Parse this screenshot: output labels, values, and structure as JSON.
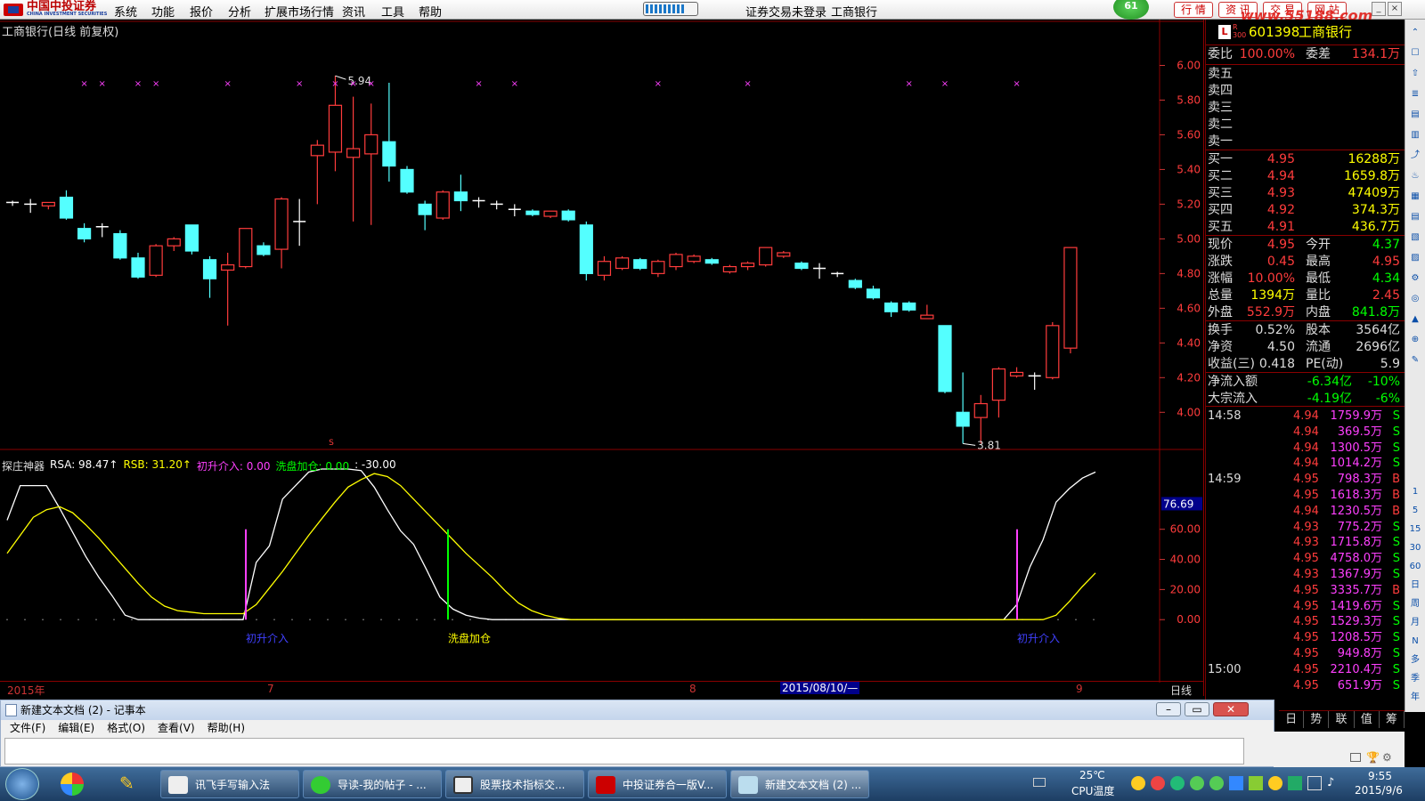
{
  "menubar": {
    "logo_cn": "中国中投证券",
    "logo_en": "CHINA INVESTMENT SECURITIES",
    "items": [
      "系统",
      "功能",
      "报价",
      "分析",
      "扩展市场行情",
      "资讯",
      "工具",
      "帮助"
    ],
    "status": "证券交易未登录",
    "stock_name": "工商银行",
    "badge": "61",
    "tabs": [
      "行 情",
      "资 讯",
      "交 易",
      "网 站"
    ],
    "watermark": "www.55188.com"
  },
  "chart": {
    "title": "工商银行(日线 前复权)",
    "price_high_label": "5.94",
    "price_low_label": "3.81",
    "price_axis": [
      "6.00",
      "5.80",
      "5.60",
      "5.40",
      "5.20",
      "5.00",
      "4.80",
      "4.60",
      "4.40",
      "4.20",
      "4.00"
    ],
    "indicator_axis": [
      "76.69",
      "60.00",
      "40.00",
      "20.00",
      "0.00"
    ],
    "timeline": [
      "2015年",
      "7",
      "8",
      "2015/08/10/—",
      "9"
    ],
    "period_label": "日线",
    "indicator_title": "探庄神器",
    "indicator_values": [
      {
        "text": "RSA: 98.47↑",
        "color": "#ffffff"
      },
      {
        "text": "RSB: 31.20↑",
        "color": "#ffff00"
      },
      {
        "text": "初升介入: 0.00",
        "color": "#ff40ff"
      },
      {
        "text": "洗盘加仓: 0.00",
        "color": "#00ff00"
      },
      {
        "text": ": -30.00",
        "color": "#ffffff"
      }
    ],
    "signal_labels": [
      {
        "text": "初升介入",
        "color": "#4040ff"
      },
      {
        "text": "洗盘加仓",
        "color": "#ffff00"
      },
      {
        "text": "初升介入",
        "color": "#4040ff"
      }
    ]
  },
  "chart_data": {
    "type": "candlestick",
    "title": "工商银行(日线 前复权)",
    "ylim": [
      3.75,
      6.1
    ],
    "candles": [
      {
        "o": 5.2,
        "c": 5.21,
        "h": 5.22,
        "l": 5.19
      },
      {
        "o": 5.19,
        "c": 5.2,
        "h": 5.23,
        "l": 5.15
      },
      {
        "o": 5.19,
        "c": 5.21,
        "h": 5.21,
        "l": 5.17
      },
      {
        "o": 5.24,
        "c": 5.12,
        "h": 5.28,
        "l": 5.11
      },
      {
        "o": 5.06,
        "c": 5.0,
        "h": 5.09,
        "l": 4.98
      },
      {
        "o": 5.06,
        "c": 5.07,
        "h": 5.09,
        "l": 5.01
      },
      {
        "o": 5.03,
        "c": 4.89,
        "h": 5.05,
        "l": 4.88
      },
      {
        "o": 4.89,
        "c": 4.78,
        "h": 4.92,
        "l": 4.77
      },
      {
        "o": 4.79,
        "c": 4.96,
        "h": 4.97,
        "l": 4.78
      },
      {
        "o": 4.96,
        "c": 5.0,
        "h": 5.01,
        "l": 4.93
      },
      {
        "o": 5.08,
        "c": 4.93,
        "h": 5.08,
        "l": 4.91
      },
      {
        "o": 4.88,
        "c": 4.77,
        "h": 4.9,
        "l": 4.66
      },
      {
        "o": 4.82,
        "c": 4.85,
        "h": 4.92,
        "l": 4.5
      },
      {
        "o": 4.84,
        "c": 5.06,
        "h": 5.06,
        "l": 4.83
      },
      {
        "o": 4.96,
        "c": 4.91,
        "h": 4.98,
        "l": 4.9
      },
      {
        "o": 4.94,
        "c": 5.23,
        "h": 5.24,
        "l": 4.83
      },
      {
        "o": 5.09,
        "c": 5.1,
        "h": 5.23,
        "l": 4.96
      },
      {
        "o": 5.48,
        "c": 5.54,
        "h": 5.57,
        "l": 5.2
      },
      {
        "o": 5.5,
        "c": 5.77,
        "h": 5.94,
        "l": 5.39
      },
      {
        "o": 5.47,
        "c": 5.52,
        "h": 5.82,
        "l": 5.1
      },
      {
        "o": 5.49,
        "c": 5.6,
        "h": 5.78,
        "l": 5.08
      },
      {
        "o": 5.56,
        "c": 5.42,
        "h": 5.9,
        "l": 5.33
      },
      {
        "o": 5.4,
        "c": 5.27,
        "h": 5.42,
        "l": 5.26
      },
      {
        "o": 5.2,
        "c": 5.14,
        "h": 5.22,
        "l": 5.05
      },
      {
        "o": 5.12,
        "c": 5.27,
        "h": 5.28,
        "l": 5.11
      },
      {
        "o": 5.27,
        "c": 5.22,
        "h": 5.37,
        "l": 5.16
      },
      {
        "o": 5.22,
        "c": 5.21,
        "h": 5.24,
        "l": 5.18
      },
      {
        "o": 5.2,
        "c": 5.19,
        "h": 5.22,
        "l": 5.17
      },
      {
        "o": 5.17,
        "c": 5.16,
        "h": 5.2,
        "l": 5.13
      },
      {
        "o": 5.16,
        "c": 5.14,
        "h": 5.17,
        "l": 5.13
      },
      {
        "o": 5.13,
        "c": 5.16,
        "h": 5.16,
        "l": 5.12
      },
      {
        "o": 5.16,
        "c": 5.11,
        "h": 5.17,
        "l": 5.1
      },
      {
        "o": 5.08,
        "c": 4.8,
        "h": 5.1,
        "l": 4.76
      },
      {
        "o": 4.79,
        "c": 4.87,
        "h": 4.9,
        "l": 4.76
      },
      {
        "o": 4.83,
        "c": 4.89,
        "h": 4.9,
        "l": 4.82
      },
      {
        "o": 4.88,
        "c": 4.83,
        "h": 4.89,
        "l": 4.82
      },
      {
        "o": 4.8,
        "c": 4.87,
        "h": 4.88,
        "l": 4.78
      },
      {
        "o": 4.84,
        "c": 4.91,
        "h": 4.92,
        "l": 4.82
      },
      {
        "o": 4.87,
        "c": 4.9,
        "h": 4.91,
        "l": 4.86
      },
      {
        "o": 4.88,
        "c": 4.86,
        "h": 4.89,
        "l": 4.85
      },
      {
        "o": 4.81,
        "c": 4.84,
        "h": 4.85,
        "l": 4.8
      },
      {
        "o": 4.84,
        "c": 4.86,
        "h": 4.87,
        "l": 4.82
      },
      {
        "o": 4.85,
        "c": 4.95,
        "h": 4.95,
        "l": 4.84
      },
      {
        "o": 4.9,
        "c": 4.92,
        "h": 4.93,
        "l": 4.89
      },
      {
        "o": 4.86,
        "c": 4.83,
        "h": 4.87,
        "l": 4.82
      },
      {
        "o": 4.83,
        "c": 4.82,
        "h": 4.86,
        "l": 4.77
      },
      {
        "o": 4.8,
        "c": 4.79,
        "h": 4.81,
        "l": 4.78
      },
      {
        "o": 4.76,
        "c": 4.72,
        "h": 4.77,
        "l": 4.71
      },
      {
        "o": 4.71,
        "c": 4.66,
        "h": 4.73,
        "l": 4.65
      },
      {
        "o": 4.63,
        "c": 4.58,
        "h": 4.64,
        "l": 4.55
      },
      {
        "o": 4.63,
        "c": 4.59,
        "h": 4.64,
        "l": 4.58
      },
      {
        "o": 4.54,
        "c": 4.56,
        "h": 4.62,
        "l": 4.54
      },
      {
        "o": 4.5,
        "c": 4.12,
        "h": 4.5,
        "l": 4.11
      },
      {
        "o": 4.0,
        "c": 3.92,
        "h": 4.23,
        "l": 3.82
      },
      {
        "o": 3.97,
        "c": 4.05,
        "h": 4.1,
        "l": 3.82
      },
      {
        "o": 4.07,
        "c": 4.25,
        "h": 4.26,
        "l": 3.97
      },
      {
        "o": 4.21,
        "c": 4.23,
        "h": 4.26,
        "l": 4.2
      },
      {
        "o": 4.2,
        "c": 4.21,
        "h": 4.23,
        "l": 4.13
      },
      {
        "o": 4.2,
        "c": 4.5,
        "h": 4.52,
        "l": 4.19
      },
      {
        "o": 4.37,
        "c": 4.95,
        "h": 4.95,
        "l": 4.34
      }
    ],
    "rsa": [
      66,
      89,
      89,
      89,
      74,
      58,
      42,
      28,
      16,
      3,
      0,
      0,
      0,
      0,
      0,
      0,
      0,
      0,
      0,
      38,
      49,
      80,
      89,
      98,
      100,
      100,
      100,
      99,
      88,
      73,
      59,
      50,
      33,
      15,
      7,
      3,
      1,
      0,
      0,
      0,
      0,
      0,
      0,
      0,
      0,
      0,
      0,
      0,
      0,
      0,
      0,
      0,
      0,
      0,
      0,
      0,
      0,
      0,
      0,
      0,
      0,
      0,
      0,
      0,
      0,
      0,
      0,
      0,
      0,
      0,
      0,
      0,
      0,
      0,
      0,
      0,
      0,
      10,
      35,
      53,
      78,
      87,
      94,
      98
    ],
    "rsb": [
      44,
      56,
      68,
      73,
      75,
      71,
      63,
      54,
      44,
      34,
      24,
      15,
      9,
      6,
      5,
      4,
      4,
      4,
      4,
      10,
      21,
      32,
      44,
      56,
      67,
      78,
      88,
      93,
      97,
      95,
      89,
      80,
      71,
      62,
      53,
      44,
      36,
      28,
      19,
      11,
      6,
      3,
      1,
      0,
      0,
      0,
      0,
      0,
      0,
      0,
      0,
      0,
      0,
      0,
      0,
      0,
      0,
      0,
      0,
      0,
      0,
      0,
      0,
      0,
      0,
      0,
      0,
      0,
      0,
      0,
      0,
      0,
      0,
      0,
      0,
      0,
      0,
      0,
      0,
      0,
      3,
      12,
      22,
      31
    ],
    "indicator_ylim": [
      -30,
      100
    ]
  },
  "quote": {
    "code": "601398",
    "name": "工商银行",
    "weibi_label": "委比",
    "weibi": "100.00%",
    "weicha_label": "委差",
    "weicha": "134.1万",
    "sell": [
      {
        "label": "卖五"
      },
      {
        "label": "卖四"
      },
      {
        "label": "卖三"
      },
      {
        "label": "卖二"
      },
      {
        "label": "卖一"
      }
    ],
    "buy": [
      {
        "label": "买一",
        "price": "4.95",
        "vol": "16288万"
      },
      {
        "label": "买二",
        "price": "4.94",
        "vol": "1659.8万"
      },
      {
        "label": "买三",
        "price": "4.93",
        "vol": "47409万"
      },
      {
        "label": "买四",
        "price": "4.92",
        "vol": "374.3万"
      },
      {
        "label": "买五",
        "price": "4.91",
        "vol": "436.7万"
      }
    ],
    "stats": [
      {
        "l1": "现价",
        "v1": "4.95",
        "c1": "#ff3c3c",
        "l2": "今开",
        "v2": "4.37",
        "c2": "#00ff00"
      },
      {
        "l1": "涨跌",
        "v1": "0.45",
        "c1": "#ff3c3c",
        "l2": "最高",
        "v2": "4.95",
        "c2": "#ff3c3c"
      },
      {
        "l1": "涨幅",
        "v1": "10.00%",
        "c1": "#ff3c3c",
        "l2": "最低",
        "v2": "4.34",
        "c2": "#00ff00"
      },
      {
        "l1": "总量",
        "v1": "1394万",
        "c1": "#ffff00",
        "l2": "量比",
        "v2": "2.45",
        "c2": "#ff3c3c"
      },
      {
        "l1": "外盘",
        "v1": "552.9万",
        "c1": "#ff3c3c",
        "l2": "内盘",
        "v2": "841.8万",
        "c2": "#00ff00"
      }
    ],
    "stats2": [
      {
        "l1": "换手",
        "v1": "0.52%",
        "l2": "股本",
        "v2": "3564亿"
      },
      {
        "l1": "净资",
        "v1": "4.50",
        "l2": "流通",
        "v2": "2696亿"
      },
      {
        "l1": "收益(三)",
        "v1": "0.418",
        "l2": "PE(动)",
        "v2": "5.9"
      }
    ],
    "flows": [
      {
        "label": "净流入额",
        "v1": "-6.34亿",
        "v2": "-10%"
      },
      {
        "label": "大宗流入",
        "v1": "-4.19亿",
        "v2": "-6%"
      }
    ],
    "ticks": [
      {
        "time": "14:58",
        "price": "4.94",
        "vol": "1759.9万",
        "bs": "S"
      },
      {
        "time": "",
        "price": "4.94",
        "vol": "369.5万",
        "bs": "S"
      },
      {
        "time": "",
        "price": "4.94",
        "vol": "1300.5万",
        "bs": "S"
      },
      {
        "time": "",
        "price": "4.94",
        "vol": "1014.2万",
        "bs": "S"
      },
      {
        "time": "14:59",
        "price": "4.95",
        "vol": "798.3万",
        "bs": "B"
      },
      {
        "time": "",
        "price": "4.95",
        "vol": "1618.3万",
        "bs": "B"
      },
      {
        "time": "",
        "price": "4.94",
        "vol": "1230.5万",
        "bs": "B"
      },
      {
        "time": "",
        "price": "4.93",
        "vol": "775.2万",
        "bs": "S"
      },
      {
        "time": "",
        "price": "4.93",
        "vol": "1715.8万",
        "bs": "S"
      },
      {
        "time": "",
        "price": "4.95",
        "vol": "4758.0万",
        "bs": "S"
      },
      {
        "time": "",
        "price": "4.93",
        "vol": "1367.9万",
        "bs": "S"
      },
      {
        "time": "",
        "price": "4.95",
        "vol": "3335.7万",
        "bs": "B"
      },
      {
        "time": "",
        "price": "4.95",
        "vol": "1419.6万",
        "bs": "S"
      },
      {
        "time": "",
        "price": "4.95",
        "vol": "1529.3万",
        "bs": "S"
      },
      {
        "time": "",
        "price": "4.95",
        "vol": "1208.5万",
        "bs": "S"
      },
      {
        "time": "",
        "price": "4.95",
        "vol": "949.8万",
        "bs": "S"
      },
      {
        "time": "15:00",
        "price": "4.95",
        "vol": "2210.4万",
        "bs": "S"
      },
      {
        "time": "",
        "price": "4.95",
        "vol": "651.9万",
        "bs": "S"
      }
    ],
    "bottom_tabs": [
      "日",
      "势",
      "联",
      "值",
      "筹"
    ]
  },
  "right_toolbar": [
    "1",
    "5",
    "15",
    "30",
    "60",
    "日",
    "周",
    "月",
    "N",
    "多",
    "季",
    "年"
  ],
  "notepad": {
    "title": "新建文本文档 (2) - 记事本",
    "menu": [
      "文件(F)",
      "编辑(E)",
      "格式(O)",
      "查看(V)",
      "帮助(H)"
    ]
  },
  "taskbar": {
    "items": [
      "讯飞手写输入法",
      "导读-我的帖子 - ...",
      "股票技术指标交...",
      "中投证券合一版V...",
      "新建文本文档 (2) ..."
    ],
    "temp": "25℃",
    "cpu_label": "CPU温度",
    "time": "9:55",
    "date": "2015/9/6"
  }
}
